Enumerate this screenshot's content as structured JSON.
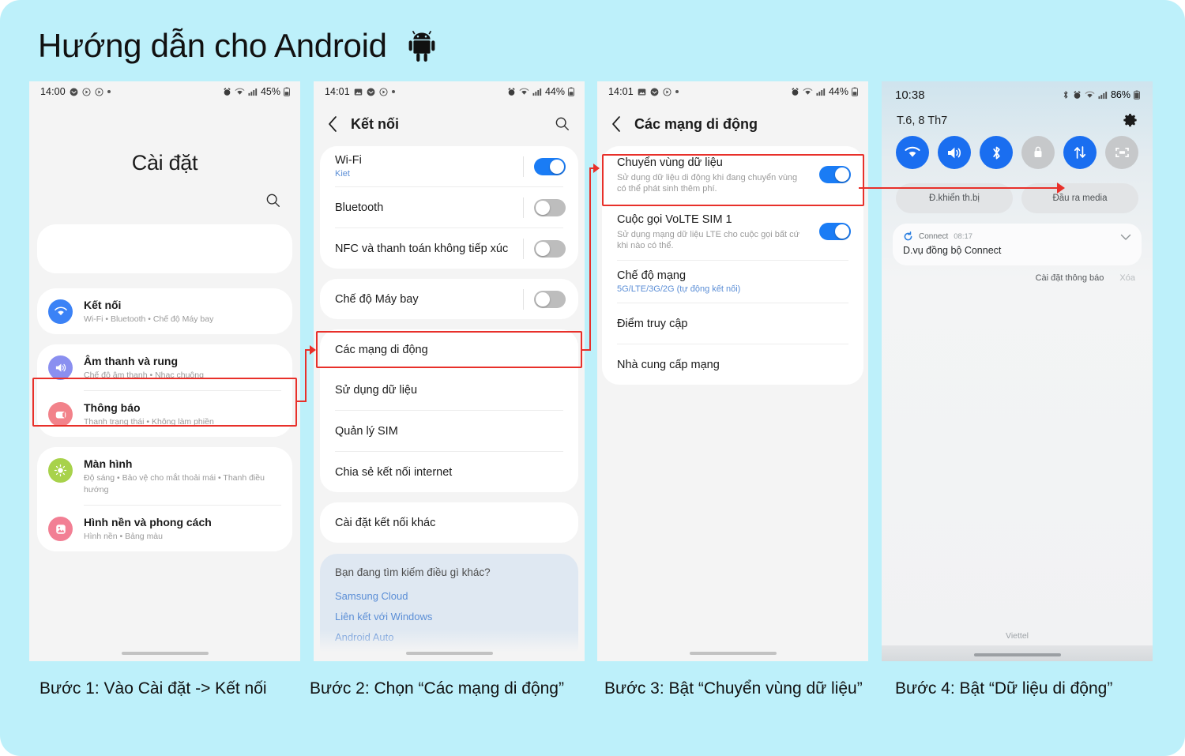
{
  "page": {
    "title": "Hướng dẫn cho Android",
    "background_color": "#bdf0fa",
    "accent_red": "#e8302a",
    "accent_blue": "#1a7cf5",
    "android_icon": "android-robot-icon"
  },
  "screen1": {
    "status": {
      "time": "14:00",
      "battery": "45%",
      "icons": [
        "message-icon",
        "play-circle-icon",
        "play-circle-icon",
        "dot-icon"
      ],
      "right_icons": [
        "alarm-icon",
        "wifi-icon",
        "signal-icon",
        "battery-icon"
      ]
    },
    "title": "Cài đặt",
    "search_icon": "search-icon",
    "items": [
      {
        "label": "Kết nối",
        "sub": "Wi-Fi • Bluetooth • Chế độ Máy bay",
        "icon": "wifi-icon",
        "icon_color": "#3b82f6",
        "highlighted": true
      },
      {
        "label": "Âm thanh và rung",
        "sub": "Chế độ âm thanh • Nhạc chuông",
        "icon": "speaker-icon",
        "icon_color": "#8a8ff0"
      },
      {
        "label": "Thông báo",
        "sub": "Thanh trạng thái • Không làm phiền",
        "icon": "notification-icon",
        "icon_color": "#f2828a"
      },
      {
        "label": "Màn hình",
        "sub": "Độ sáng • Bảo vệ cho mắt thoải mái • Thanh điều hướng",
        "icon": "brightness-icon",
        "icon_color": "#a8d24b"
      },
      {
        "label": "Hình nền và phong cách",
        "sub": "Hình nền • Bảng màu",
        "icon": "wallpaper-icon",
        "icon_color": "#f27f94"
      }
    ]
  },
  "screen2": {
    "status": {
      "time": "14:01",
      "battery": "44%"
    },
    "back_icon": "back-chevron-icon",
    "title": "Kết nối",
    "search_icon": "search-icon",
    "group1": [
      {
        "label": "Wi-Fi",
        "sub": "Kiet",
        "toggle": "on"
      },
      {
        "label": "Bluetooth",
        "toggle": "off"
      },
      {
        "label": "NFC và thanh toán không tiếp xúc",
        "toggle": "off"
      }
    ],
    "group2": [
      {
        "label": "Chế độ Máy bay",
        "toggle": "off"
      }
    ],
    "group3": [
      {
        "label": "Các mạng di động",
        "highlighted": true
      },
      {
        "label": "Sử dụng dữ liệu"
      },
      {
        "label": "Quản lý SIM"
      },
      {
        "label": "Chia sẻ kết nối internet"
      }
    ],
    "group4": [
      {
        "label": "Cài đặt kết nối khác"
      }
    ],
    "suggestions": {
      "title": "Bạn đang tìm kiếm điều gì khác?",
      "links": [
        "Samsung Cloud",
        "Liên kết với Windows",
        "Android Auto"
      ]
    }
  },
  "screen3": {
    "status": {
      "time": "14:01",
      "battery": "44%"
    },
    "back_icon": "back-chevron-icon",
    "title": "Các mạng di động",
    "items": [
      {
        "label": "Chuyển vùng dữ liệu",
        "sub": "Sử dụng dữ liệu di động khi đang chuyển vùng có thể phát sinh thêm phí.",
        "toggle": "on",
        "highlighted": true
      },
      {
        "label": "Cuộc gọi VoLTE SIM 1",
        "sub": "Sử dụng mạng dữ liệu LTE cho cuộc gọi bất cứ khi nào có thể.",
        "toggle": "on"
      },
      {
        "label": "Chế độ mạng",
        "sub": "5G/LTE/3G/2G (tự động kết nối)"
      },
      {
        "label": "Điểm truy cập"
      },
      {
        "label": "Nhà cung cấp mạng"
      }
    ]
  },
  "screen4": {
    "status": {
      "time": "10:38",
      "battery": "86%"
    },
    "date": "T.6, 8 Th7",
    "gear_icon": "gear-icon",
    "tiles": [
      {
        "name": "wifi-tile",
        "icon": "wifi-icon",
        "state": "on"
      },
      {
        "name": "sound-tile",
        "icon": "speaker-icon",
        "state": "on"
      },
      {
        "name": "bluetooth-tile",
        "icon": "bluetooth-icon",
        "state": "on"
      },
      {
        "name": "auto-rotate-tile",
        "icon": "rotation-lock-icon",
        "state": "off"
      },
      {
        "name": "mobile-data-tile",
        "icon": "data-arrows-icon",
        "state": "on"
      },
      {
        "name": "screen-cast-tile",
        "icon": "smart-view-icon",
        "state": "off"
      }
    ],
    "pills": [
      "Đ.khiển th.bị",
      "Đầu ra media"
    ],
    "notification": {
      "app": "Connect",
      "time": "08:17",
      "body": "D.vụ đồng bộ Connect",
      "icon": "sync-icon",
      "chevron": "chevron-down-icon"
    },
    "actions": {
      "settings": "Cài đặt thông báo",
      "clear": "Xóa"
    },
    "carrier": "Viettel"
  },
  "captions": [
    "Bước 1: Vào Cài đặt -> Kết nối",
    "Bước 2: Chọn “Các mạng di động”",
    "Bước 3: Bật “Chuyển vùng dữ liệu”",
    "Bước 4: Bật “Dữ liệu di động”"
  ]
}
